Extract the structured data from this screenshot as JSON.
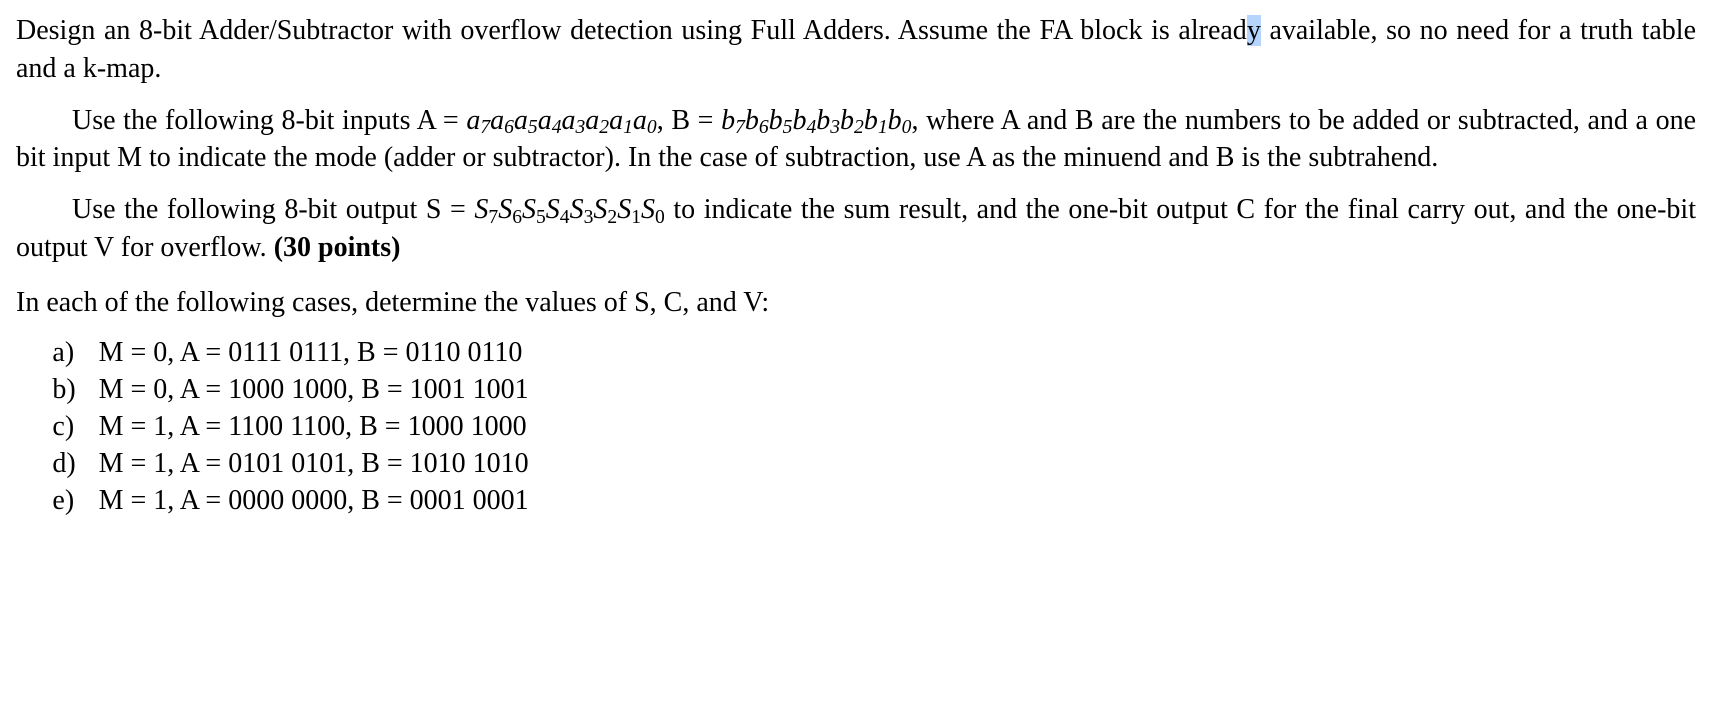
{
  "paragraphs": {
    "p1_part1": "Design an 8-bit Adder/Subtractor with overflow detection using Full Adders. Assume the FA block is alread",
    "p1_selected": "y",
    "p1_part2": " available, so no need for a truth table and a k-map.",
    "p2_part1_before": "Use the following 8-bit inputs ",
    "p2_A_eq": "A = ",
    "p2_Avar": "a",
    "p2_between": ", ",
    "p2_B_eq": "B = ",
    "p2_Bvar": "b",
    "p2_after": ", where A and B are the numbers to be added or subtracted, and a one bit input M to indicate the mode (adder or subtractor). In the case of subtraction, use A as the minuend and B is the subtrahend.",
    "p3_part1": "Use the following 8-bit output ",
    "p3_S_eq": "S = ",
    "p3_Svar": "S",
    "p3_part2_mid": " to indicate the sum result, and the one-bit output C for the final carry out, and the one-bit output V for overflow. ",
    "p3_points": "(30 points)",
    "cases_intro": "In each of the following cases, determine the values of S, C, and V:"
  },
  "subscripts": [
    "7",
    "6",
    "5",
    "4",
    "3",
    "2",
    "1",
    "0"
  ],
  "cases": [
    {
      "label": "a)",
      "M": "M = 0",
      "A": "A = 0111 0111",
      "B": "B = 0110 0110"
    },
    {
      "label": "b)",
      "M": "M = 0",
      "A": "A = 1000 1000",
      "B": "B = 1001 1001"
    },
    {
      "label": "c)",
      "M": "M = 1",
      "A": "A = 1100 1100",
      "B": "B = 1000 1000"
    },
    {
      "label": "d)",
      "M": "M = 1",
      "A": "A = 0101 0101",
      "B": "B = 1010 1010"
    },
    {
      "label": "e)",
      "M": "M = 1",
      "A": "A = 0000 0000",
      "B": "B = 0001 0001"
    }
  ]
}
